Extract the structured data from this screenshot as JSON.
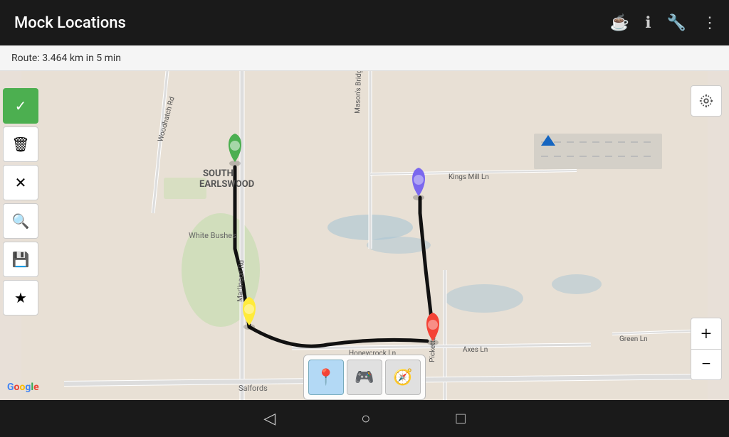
{
  "topbar": {
    "title": "Mock Locations",
    "icons": [
      "☕",
      "ℹ",
      "🔧",
      "⋮"
    ]
  },
  "routebar": {
    "text": "Route: 3.464 km in 5 min"
  },
  "left_toolbar": {
    "buttons": [
      {
        "id": "check",
        "icon": "✓",
        "active": true,
        "label": "confirm-button"
      },
      {
        "id": "trash",
        "icon": "🗑",
        "active": false,
        "label": "delete-button"
      },
      {
        "id": "close",
        "icon": "✕",
        "active": false,
        "label": "clear-button"
      },
      {
        "id": "search",
        "icon": "🔍",
        "active": false,
        "label": "search-button"
      },
      {
        "id": "save",
        "icon": "💾",
        "active": false,
        "label": "save-button"
      },
      {
        "id": "star",
        "icon": "★",
        "active": false,
        "label": "favorite-button"
      }
    ]
  },
  "bottom_toolbar": {
    "buttons": [
      {
        "id": "location",
        "icon": "📍",
        "active": true,
        "label": "location-mode-button"
      },
      {
        "id": "gamepad",
        "icon": "🎮",
        "active": false,
        "label": "gamepad-button"
      },
      {
        "id": "compass",
        "icon": "🧭",
        "active": false,
        "label": "compass-button"
      }
    ]
  },
  "zoom": {
    "plus": "+",
    "minus": "−"
  },
  "navBar": {
    "back": "◁",
    "home": "○",
    "recent": "□"
  },
  "map": {
    "area_label": "South Earlswood map",
    "labels": [
      "SOUTH EARLSWOOD",
      "White Bushes",
      "Salfords"
    ],
    "route_info": "Route path shown on map"
  },
  "colors": {
    "pin_green": "#4caf50",
    "pin_purple": "#7b68ee",
    "pin_yellow": "#ffeb3b",
    "pin_red": "#f44336",
    "pin_blue": "#2196f3",
    "route_line": "#111111"
  }
}
